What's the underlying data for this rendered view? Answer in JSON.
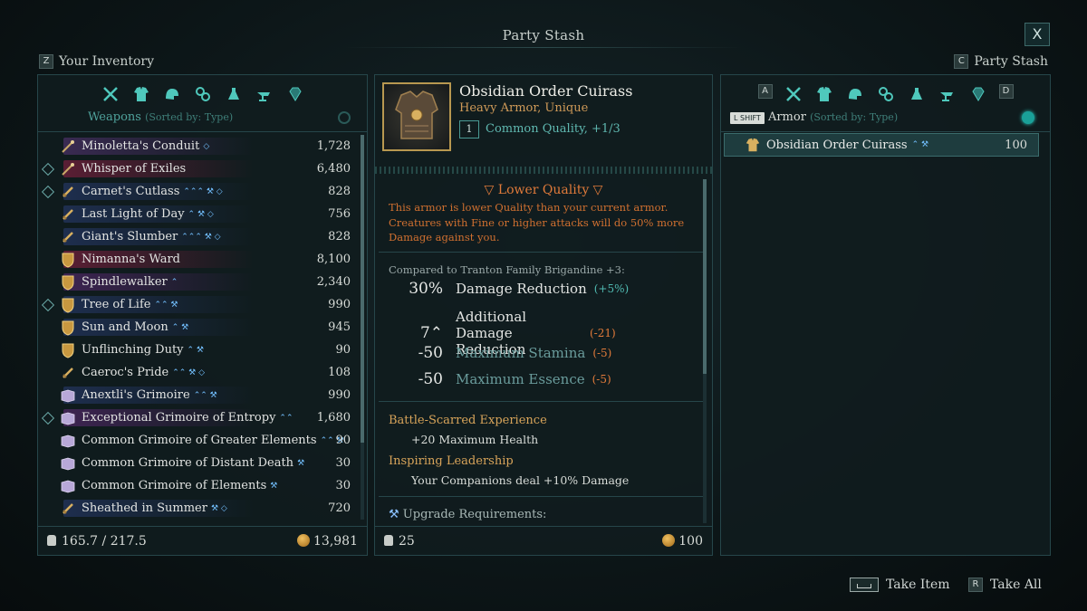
{
  "screen_title": "Party Stash",
  "close_label": "X",
  "left_header": {
    "key": "Z",
    "label": "Your Inventory"
  },
  "right_header": {
    "key": "C",
    "label": "Party Stash"
  },
  "left_panel": {
    "category": "Weapons",
    "sort": "(Sorted by: Type)",
    "tabs": [
      "weapons-icon",
      "armor-icon",
      "helmet-icon",
      "accessory-icon",
      "consumable-icon",
      "crafting-icon",
      "gem-icon"
    ],
    "items": [
      {
        "name": "Minoletta's Conduit",
        "symbols": "◇",
        "value": "1,728",
        "tint": "#3a2a52",
        "marked": false,
        "icon": "wand"
      },
      {
        "name": "Whisper of Exiles",
        "symbols": "",
        "value": "6,480",
        "tint": "#5a1e34",
        "marked": true,
        "icon": "wand"
      },
      {
        "name": "Carnet's Cutlass",
        "symbols": "⌃⌃⌃ ⚒ ◇",
        "value": "828",
        "tint": "#1e2e4e",
        "marked": true,
        "icon": "sword"
      },
      {
        "name": "Last Light of Day",
        "symbols": "⌃ ⚒ ◇",
        "value": "756",
        "tint": "#1e2e4e",
        "marked": false,
        "icon": "sword"
      },
      {
        "name": "Giant's Slumber",
        "symbols": "⌃⌃⌃ ⚒ ◇",
        "value": "828",
        "tint": "#1e2e4e",
        "marked": false,
        "icon": "sword"
      },
      {
        "name": "Nimanna's Ward",
        "symbols": "",
        "value": "8,100",
        "tint": "#5a1e34",
        "marked": false,
        "icon": "shield"
      },
      {
        "name": "Spindlewalker",
        "symbols": "⌃",
        "value": "2,340",
        "tint": "#3e2452",
        "marked": false,
        "icon": "shield"
      },
      {
        "name": "Tree of Life",
        "symbols": "⌃⌃ ⚒",
        "value": "990",
        "tint": "#1e2e4e",
        "marked": true,
        "icon": "shield"
      },
      {
        "name": "Sun and Moon",
        "symbols": "⌃ ⚒",
        "value": "945",
        "tint": "#1e2e4e",
        "marked": false,
        "icon": "shield"
      },
      {
        "name": "Unflinching Duty",
        "symbols": "⌃ ⚒",
        "value": "90",
        "tint": "",
        "marked": false,
        "icon": "shield"
      },
      {
        "name": "Caeroc's Pride",
        "symbols": "⌃⌃ ⚒ ◇",
        "value": "108",
        "tint": "",
        "marked": false,
        "icon": "sword"
      },
      {
        "name": "Anextli's Grimoire",
        "symbols": "⌃⌃ ⚒",
        "value": "990",
        "tint": "#1e2e4e",
        "marked": false,
        "icon": "book"
      },
      {
        "name": "Exceptional Grimoire of Entropy",
        "symbols": "⌃⌃",
        "value": "1,680",
        "tint": "#3e2452",
        "marked": true,
        "icon": "book"
      },
      {
        "name": "Common Grimoire of Greater Elements",
        "symbols": "⌃⌃ ⚒",
        "value": "90",
        "tint": "",
        "marked": false,
        "icon": "book"
      },
      {
        "name": "Common Grimoire of Distant Death",
        "symbols": "⚒",
        "value": "30",
        "tint": "",
        "marked": false,
        "icon": "book"
      },
      {
        "name": "Common Grimoire of Elements",
        "symbols": "⚒",
        "value": "30",
        "tint": "",
        "marked": false,
        "icon": "book"
      },
      {
        "name": "Sheathed in Summer",
        "symbols": "⚒ ◇",
        "value": "720",
        "tint": "#1e2e4e",
        "marked": false,
        "icon": "sword"
      }
    ],
    "weight": "165.7 / 217.5",
    "gold": "13,981"
  },
  "detail": {
    "name": "Obsidian Order Cuirass",
    "subtitle": "Heavy Armor, Unique",
    "level": "1",
    "quality": "Common Quality, +1/3",
    "warning_title": "Lower Quality",
    "warning_text": "This armor is lower Quality than your current armor. Creatures with Fine or higher attacks will do 50% more Damage against you.",
    "compare_text": "Compared to Tranton Family Brigandine +3:",
    "stats": [
      {
        "value": "30%",
        "label": "Damage Reduction",
        "delta": "(+5%)",
        "delta_color": "#4fb8b0",
        "dim": false
      },
      {
        "value": "7⌃",
        "label": "Additional Damage Reduction",
        "delta": "(-21)",
        "delta_color": "#e07a3a",
        "dim": false
      },
      {
        "value": "-50",
        "label": "Maximum Stamina",
        "delta": "(-5)",
        "delta_color": "#e07a3a",
        "dim": true
      },
      {
        "value": "-50",
        "label": "Maximum Essence",
        "delta": "(-5)",
        "delta_color": "#e07a3a",
        "dim": true
      }
    ],
    "perks": [
      {
        "title": "Battle-Scarred Experience",
        "desc": "+20 Maximum Health"
      },
      {
        "title": "Inspiring Leadership",
        "desc": "Your Companions deal +10% Damage"
      }
    ],
    "upgrade_label": "Upgrade Requirements:",
    "weight": "25",
    "gold": "100"
  },
  "right_panel": {
    "prev_key": "A",
    "next_key": "D",
    "shift_key": "L SHIFT",
    "category": "Armor",
    "sort": "(Sorted by: Type)",
    "tabs": [
      "weapons-icon",
      "armor-icon",
      "helmet-icon",
      "accessory-icon",
      "consumable-icon",
      "crafting-icon",
      "gem-icon"
    ],
    "items": [
      {
        "name": "Obsidian Order Cuirass",
        "symbols": "⌃ ⚒",
        "value": "100"
      }
    ]
  },
  "hints": [
    {
      "key": "space",
      "label": "Take Item"
    },
    {
      "key": "R",
      "label": "Take All"
    }
  ],
  "colors": {
    "accent": "#4fa29b",
    "warning": "#e07a3a",
    "gold": "#d8a45a"
  }
}
